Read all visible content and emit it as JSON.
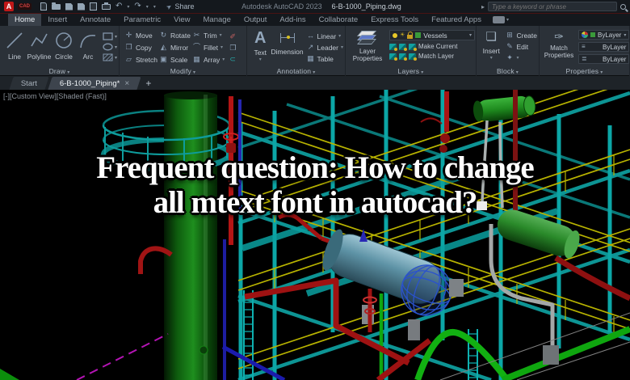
{
  "titlebar": {
    "logo_text": "A",
    "logo_sub": "CAD",
    "share_label": "Share",
    "app_title": "Autodesk AutoCAD 2023",
    "doc_title": "6-B-1000_Piping.dwg",
    "search_placeholder": "Type a keyword or phrase"
  },
  "ribbon_tabs": {
    "items": [
      {
        "label": "Home"
      },
      {
        "label": "Insert"
      },
      {
        "label": "Annotate"
      },
      {
        "label": "Parametric"
      },
      {
        "label": "View"
      },
      {
        "label": "Manage"
      },
      {
        "label": "Output"
      },
      {
        "label": "Add-ins"
      },
      {
        "label": "Collaborate"
      },
      {
        "label": "Express Tools"
      },
      {
        "label": "Featured Apps"
      }
    ]
  },
  "panels": {
    "draw": {
      "label": "Draw",
      "tools": [
        "Line",
        "Polyline",
        "Circle",
        "Arc"
      ]
    },
    "modify": {
      "label": "Modify",
      "tools": [
        "Move",
        "Rotate",
        "Trim",
        "Copy",
        "Mirror",
        "Fillet",
        "Stretch",
        "Scale",
        "Array"
      ]
    },
    "annotation": {
      "label": "Annotation",
      "text_tool": "Text",
      "dimension_tool": "Dimension",
      "side_tools": [
        "Linear",
        "Leader",
        "Table"
      ]
    },
    "layers": {
      "label": "Layers",
      "layer_properties": "Layer Properties",
      "dropdown_value": "Vessels",
      "make_current": "Make Current",
      "match_layer": "Match Layer"
    },
    "block": {
      "label": "Block",
      "insert": "Insert",
      "create": "Create",
      "edit": "Edit"
    },
    "properties": {
      "label": "Properties",
      "match_properties": "Match Properties",
      "color": "ByLayer",
      "lineweight": "ByLayer",
      "linetype": "ByLayer"
    }
  },
  "file_tabs": {
    "start": "Start",
    "document": "6-B-1000_Piping*"
  },
  "viewport": {
    "label": "[-][Custom View][Shaded (Fast)]"
  },
  "overlay": {
    "line1": "Frequent question: How to change",
    "line2": "all mtext font in autocad?"
  },
  "icons": {
    "caret": "▾",
    "undo": "↶",
    "redo": "↷",
    "share_plane": "➤",
    "close": "×",
    "plus": "+",
    "arrow_right": "▸",
    "move": "✛",
    "rotate": "↻",
    "trim": "✂",
    "copy": "❐",
    "mirror": "◭",
    "fillet": "⌒",
    "stretch": "▱",
    "scale": "▣",
    "array": "▦",
    "erase": "✐",
    "explode": "❒",
    "join": "⊂",
    "text_big": "A",
    "linear": "↔",
    "leader": "↗",
    "table": "▦",
    "sun": "☀",
    "insert_block": "❏",
    "create_block": "⊞",
    "edit_block": "✎",
    "block_extra": "✦",
    "match_brush": "✑",
    "lineweight": "≡",
    "linetype": "≣"
  },
  "colors": {
    "accent_red": "#c01818",
    "ribbon_bg": "#2b3138",
    "viewport_bg": "#000000",
    "structure_teal": "#0d9494",
    "railing_yellow": "#b7b200",
    "vessel_green": "#1e8e1e",
    "pipe_red": "#a01212",
    "exchanger_blue": "#5e93a6"
  }
}
